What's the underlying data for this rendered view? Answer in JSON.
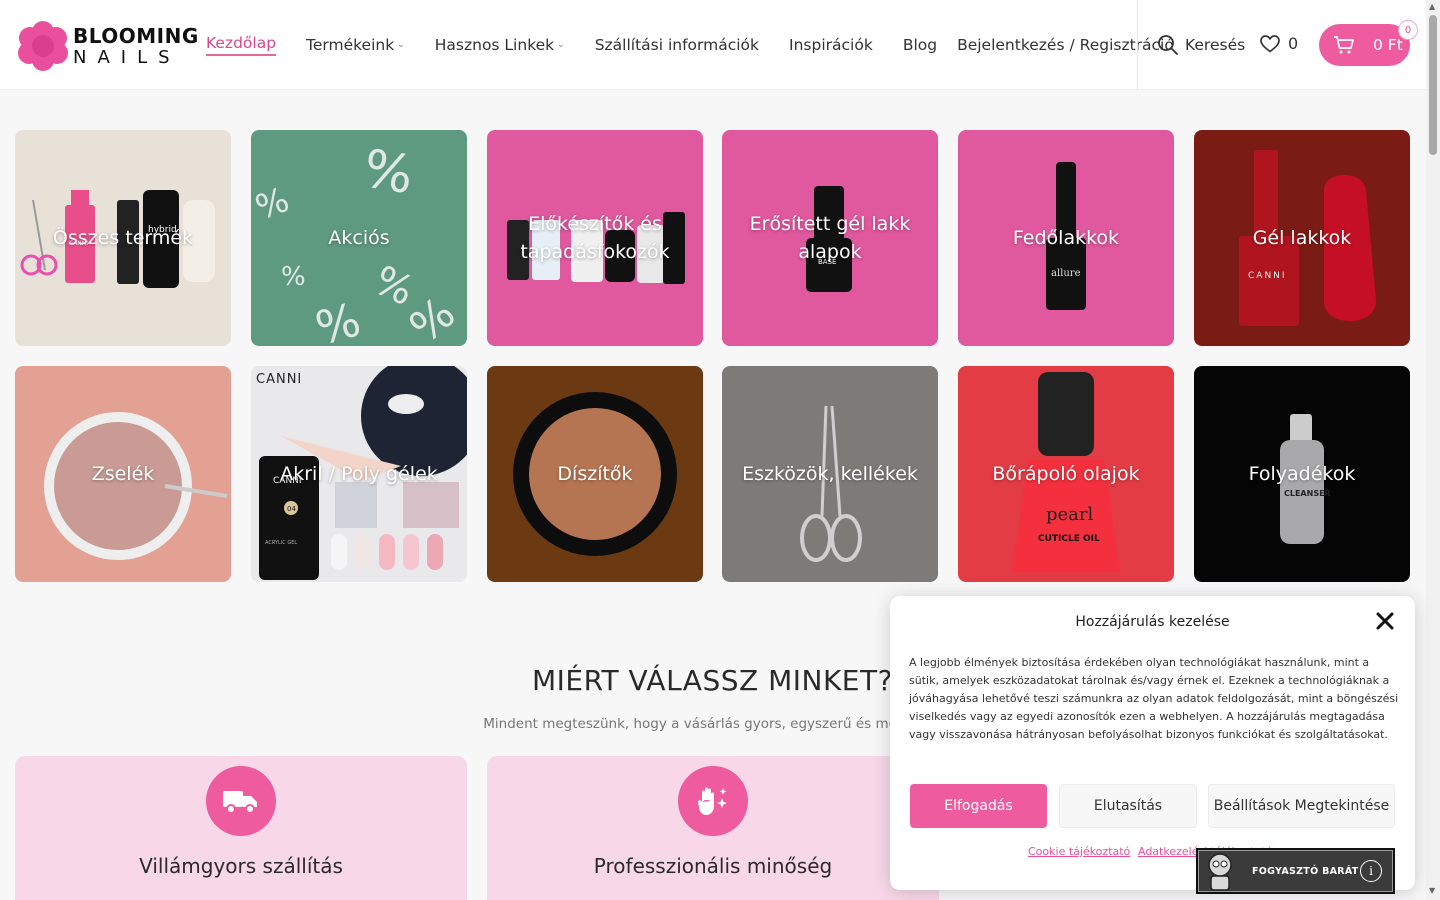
{
  "header": {
    "logo_line1": "BLOOMING",
    "logo_line2": "NAILS",
    "nav": [
      {
        "label": "Kezdőlap",
        "active": true,
        "dropdown": false
      },
      {
        "label": "Termékeink",
        "active": false,
        "dropdown": true
      },
      {
        "label": "Hasznos Linkek",
        "active": false,
        "dropdown": true
      },
      {
        "label": "Szállítási információk",
        "active": false,
        "dropdown": false
      },
      {
        "label": "Inspirációk",
        "active": false,
        "dropdown": false
      },
      {
        "label": "Blog",
        "active": false,
        "dropdown": false
      },
      {
        "label": "Bejelentkezés / Regisztráció",
        "active": false,
        "dropdown": false
      }
    ],
    "search_label": "Keresés",
    "wishlist_count": "0",
    "cart_amount": "0 Ft",
    "cart_count": "0",
    "accent_color": "#ee5b9f"
  },
  "categories": [
    {
      "label": "Összes termék",
      "bg": "#e8e1d8"
    },
    {
      "label": "Akciós",
      "bg": "#5e9a80"
    },
    {
      "label": "Előkészítők és tapadásfokozók",
      "bg": "#e0589e"
    },
    {
      "label": "Erősített gél lakk alapok",
      "bg": "#e0589e"
    },
    {
      "label": "Fedőlakkok",
      "bg": "#e0589e"
    },
    {
      "label": "Gél lakkok",
      "bg": "#7a1c14"
    },
    {
      "label": "Zselék",
      "bg": "#e3a193"
    },
    {
      "label": "Akril / Poly gélek",
      "bg": "#e9e9ec"
    },
    {
      "label": "Díszítők",
      "bg": "#6b3a12"
    },
    {
      "label": "Eszközök, kellékek",
      "bg": "#7d7b78"
    },
    {
      "label": "Bőrápoló olajok",
      "bg": "#e33c44"
    },
    {
      "label": "Folyadékok",
      "bg": "#050505"
    }
  ],
  "product_text": {
    "canni": "CANNI",
    "allure": "allure",
    "base": "BASE",
    "pearl": "pearl",
    "cuticle_oil": "CUTICLE OIL",
    "cleanser": "CLEANSER",
    "hybrid": "hybrid",
    "acrylic_gel": "ACRYLIC GEL",
    "shade": "04"
  },
  "why": {
    "title": "MIÉRT VÁLASSZ MINKET?",
    "subtitle": "Mindent megteszünk, hogy a vásárlás gyors, egyszerű és megbízha",
    "features": [
      {
        "title": "Villámgyors szállítás",
        "icon": "truck-icon"
      },
      {
        "title": "Professzionális minőség",
        "icon": "sparkle-hand-icon"
      }
    ]
  },
  "consent": {
    "title": "Hozzájárulás kezelése",
    "text": "A legjobb élmények biztosítása érdekében olyan technológiákat használunk, mint a sütik, amelyek eszközadatokat tárolnak és/vagy érnek el. Ezeknek a technológiáknak a jóváhagyása lehetővé teszi számunkra az olyan adatok feldolgozását, mint a böngészési viselkedés vagy az egyedi azonosítók ezen a webhelyen. A hozzájárulás megtagadása vagy visszavonása hátrányosan befolyásolhat bizonyos funkciókat és szolgáltatásokat.",
    "accept": "Elfogadás",
    "deny": "Elutasítás",
    "settings": "Beállítások Megtekintése",
    "link_cookie": "Cookie tájékoztató",
    "link_privacy": "Adatkezelési tájékoztató"
  },
  "accessibility": {
    "label": "FOGYASZTÓ BARÁT",
    "info_glyph": "i"
  }
}
